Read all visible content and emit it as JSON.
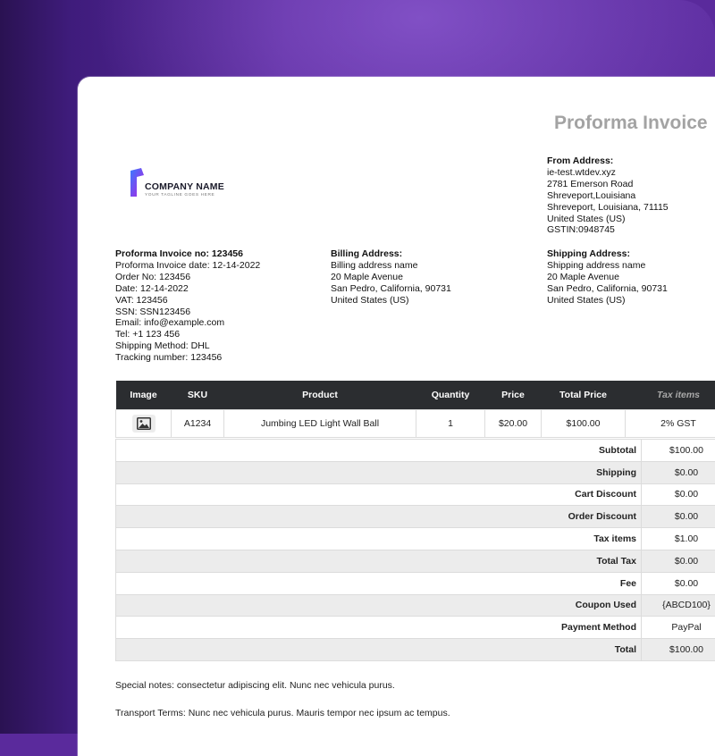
{
  "invoice": {
    "title": "Proforma Invoice",
    "company": {
      "name": "COMPANY NAME",
      "tagline": "YOUR TAGLINE GOES HERE"
    },
    "from": {
      "heading": "From Address:",
      "lines": [
        "ie-test.wtdev.xyz",
        "2781 Emerson Road",
        "Shreveport,Louisiana",
        "Shreveport, Louisiana, 71115",
        "United States (US)",
        "GSTIN:0948745"
      ]
    },
    "details": {
      "heading": "Proforma Invoice no: 123456",
      "lines": [
        "Proforma Invoice date: 12-14-2022",
        "Order No: 123456",
        "Date: 12-14-2022",
        "VAT: 123456",
        "SSN: SSN123456",
        "Email: info@example.com",
        "Tel: +1 123 456",
        "Shipping Method: DHL",
        "Tracking number: 123456"
      ]
    },
    "billing": {
      "heading": "Billing Address:",
      "lines": [
        "Billing address name",
        "20 Maple Avenue",
        "San Pedro, California, 90731",
        "United States (US)"
      ]
    },
    "shipping": {
      "heading": "Shipping Address:",
      "lines": [
        "Shipping address name",
        "20 Maple Avenue",
        "San Pedro, California, 90731",
        "United States (US)"
      ]
    },
    "table": {
      "headers": [
        "Image",
        "SKU",
        "Product",
        "Quantity",
        "Price",
        "Total Price",
        "Tax items"
      ],
      "item": {
        "sku": "A1234",
        "product": "Jumbing LED Light Wall Ball",
        "quantity": "1",
        "price": "$20.00",
        "total_price": "$100.00",
        "tax": "2% GST"
      }
    },
    "totals": [
      {
        "label": "Subtotal",
        "value": "$100.00"
      },
      {
        "label": "Shipping",
        "value": "$0.00"
      },
      {
        "label": "Cart Discount",
        "value": "$0.00"
      },
      {
        "label": "Order Discount",
        "value": "$0.00"
      },
      {
        "label": "Tax items",
        "value": "$1.00"
      },
      {
        "label": "Total Tax",
        "value": "$0.00"
      },
      {
        "label": "Fee",
        "value": "$0.00"
      },
      {
        "label": "Coupon Used",
        "value": "{ABCD100}"
      },
      {
        "label": "Payment Method",
        "value": "PayPal"
      },
      {
        "label": "Total",
        "value": "$100.00"
      }
    ],
    "special_notes": "Special notes: consectetur adipiscing elit. Nunc nec vehicula purus.",
    "transport_terms": "Transport Terms: Nunc nec vehicula purus. Mauris tempor nec ipsum ac tempus."
  },
  "colors": {
    "background": "#5a2a9c",
    "header_row": "#2b2d30",
    "title": "#a3a3a3",
    "stripe": "#ececec"
  }
}
